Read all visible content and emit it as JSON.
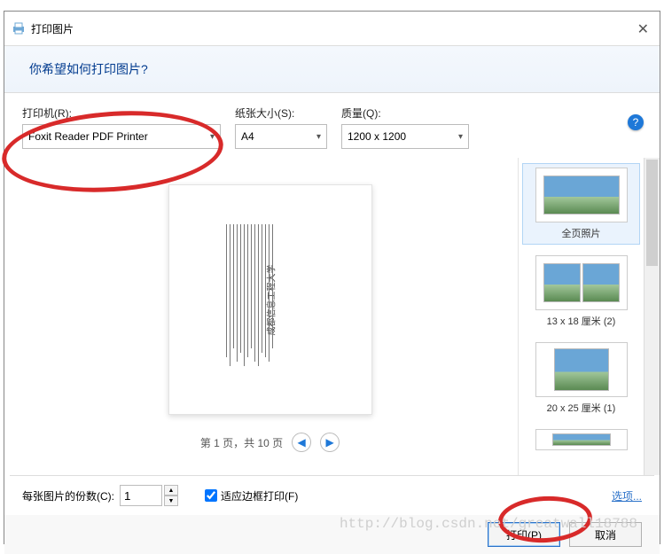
{
  "titlebar": {
    "title": "打印图片"
  },
  "banner": {
    "question": "你希望如何打印图片?"
  },
  "options": {
    "printer_label": "打印机(R):",
    "printer_value": "Foxit Reader PDF Printer",
    "paper_label": "纸张大小(S):",
    "paper_value": "A4",
    "quality_label": "质量(Q):",
    "quality_value": "1200 x 1200"
  },
  "preview": {
    "pager_text": "第 1 页，共 10 页"
  },
  "layouts": {
    "full": "全页照片",
    "l13x18": "13 x 18 厘米 (2)",
    "l20x25": "20 x 25 厘米 (1)"
  },
  "bottom": {
    "copies_label": "每张图片的份数(C):",
    "copies_value": "1",
    "fit_label": "适应边框打印(F)",
    "options_link": "选项..."
  },
  "actions": {
    "print": "打印(P)",
    "cancel": "取消"
  },
  "watermark": "http://blog.csdn.net/greatwall18788"
}
